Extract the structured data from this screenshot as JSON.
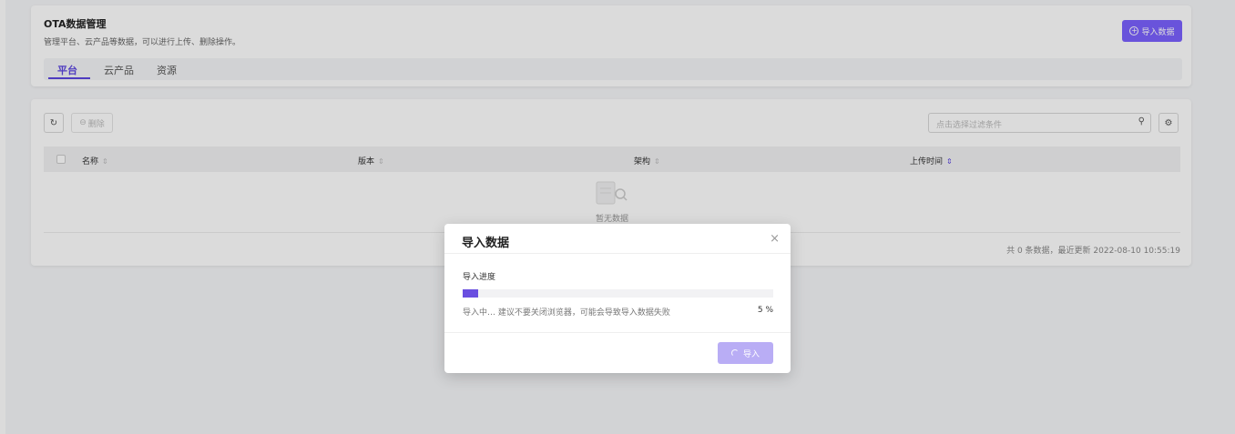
{
  "header": {
    "title": "OTA数据管理",
    "subtitle": "管理平台、云产品等数据，可以进行上传、删除操作。",
    "import_button": "导入数据",
    "tabs": [
      {
        "label": "平台",
        "active": true
      },
      {
        "label": "云产品",
        "active": false
      },
      {
        "label": "资源",
        "active": false
      }
    ]
  },
  "toolbar": {
    "refresh_icon": "refresh-icon",
    "delete_label": "删除",
    "filter_placeholder": "点击选择过滤条件",
    "search_icon": "search-icon",
    "settings_icon": "gear-icon"
  },
  "table": {
    "columns": [
      "名称",
      "版本",
      "架构",
      "上传时间"
    ],
    "sort_marker": "⇕",
    "empty_text": "暂无数据",
    "footer": "共 0 条数据，最近更新  2022-08-10 10:55:19"
  },
  "modal": {
    "title": "导入数据",
    "close_glyph": "×",
    "progress_label": "导入进度",
    "progress_percent": 5,
    "progress_text": "5 %",
    "hint": "导入中… 建议不要关闭浏览器，可能会导致导入数据失败",
    "submit_label": "导入"
  },
  "colors": {
    "accent": "#7b61ff",
    "progress_fill": "#6a4fe0",
    "disabled_button": "#b9adf5"
  }
}
